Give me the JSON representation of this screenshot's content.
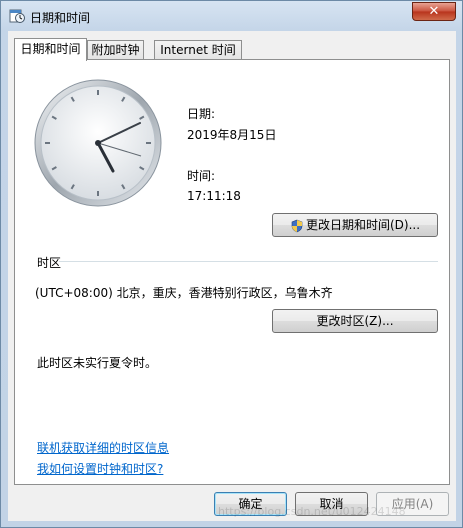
{
  "window": {
    "title": "日期和时间",
    "close_label": "✕"
  },
  "tabs": [
    {
      "label": "日期和时间",
      "active": true
    },
    {
      "label": "附加时钟",
      "active": false
    },
    {
      "label": "Internet 时间",
      "active": false
    }
  ],
  "datetime": {
    "date_label": "日期:",
    "date_value": "2019年8月15日",
    "time_label": "时间:",
    "time_value": "17:11:18",
    "change_button": "更改日期和时间(D)..."
  },
  "timezone": {
    "section_label": "时区",
    "value": "(UTC+08:00) 北京，重庆，香港特别行政区，乌鲁木齐",
    "change_button": "更改时区(Z)...",
    "dst_note": "此时区未实行夏令时。"
  },
  "links": {
    "online_info": "联机获取详细的时区信息",
    "howto": "我如何设置时钟和时区?"
  },
  "footer": {
    "ok": "确定",
    "cancel": "取消",
    "apply": "应用(A)"
  },
  "watermark": "https://blog.csdn.net/u012424148",
  "colors": {
    "link": "#0066cc",
    "accent": "#3c7fb1"
  },
  "icons": {
    "title": "clock-calendar-icon",
    "shield": "uac-shield-icon"
  }
}
